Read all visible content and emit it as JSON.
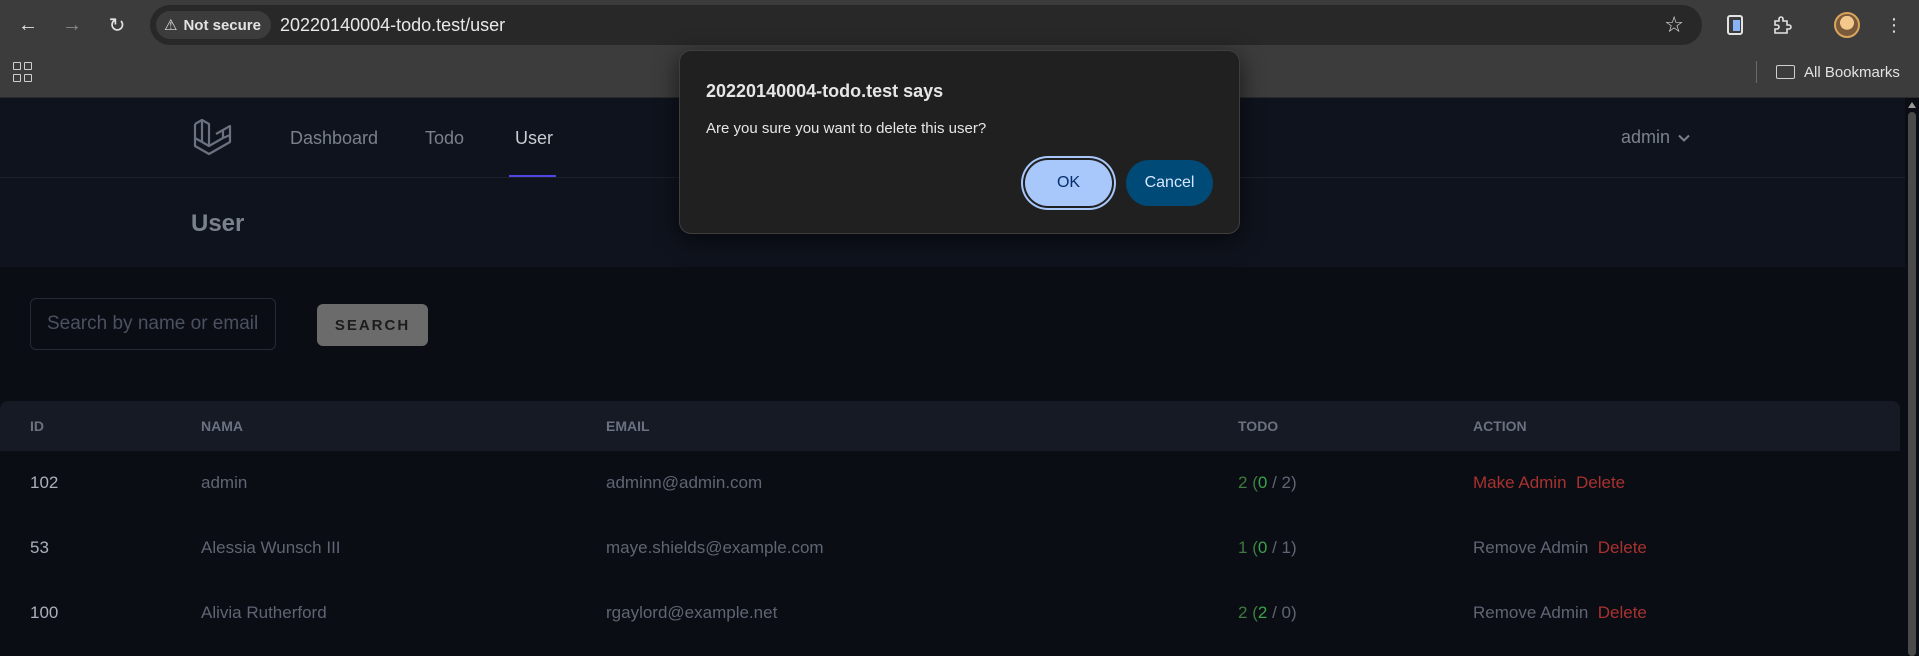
{
  "browser": {
    "security_label": "Not secure",
    "url": "20220140004-todo.test/user",
    "bookmarks_label": "All Bookmarks",
    "icons": [
      "back-arrow-icon",
      "forward-arrow-icon",
      "reload-icon",
      "warning-icon",
      "star-icon",
      "side-panel-icon",
      "extensions-icon",
      "profile-avatar",
      "kebab-menu-icon",
      "apps-grid-icon",
      "folder-icon"
    ]
  },
  "nav": {
    "links": [
      "Dashboard",
      "Todo",
      "User"
    ],
    "active": "User",
    "user_menu": "admin"
  },
  "header": {
    "title": "User"
  },
  "search": {
    "placeholder": "Search by name or email",
    "button_label": "SEARCH"
  },
  "table": {
    "headers": [
      "ID",
      "NAMA",
      "EMAIL",
      "TODO",
      "ACTION"
    ],
    "rows": [
      {
        "id": "102",
        "name": "admin",
        "email": "adminn@admin.com",
        "todo_total": "2",
        "todo_done": "0",
        "todo_rest": "2",
        "action_primary": "Make Admin",
        "action_delete": "Delete"
      },
      {
        "id": "53",
        "name": "Alessia Wunsch III",
        "email": "maye.shields@example.com",
        "todo_total": "1",
        "todo_done": "0",
        "todo_rest": "1",
        "action_primary": "Remove Admin",
        "action_delete": "Delete"
      },
      {
        "id": "100",
        "name": "Alivia Rutherford",
        "email": "rgaylord@example.net",
        "todo_total": "2",
        "todo_done": "2",
        "todo_rest": "0",
        "action_primary": "Remove Admin",
        "action_delete": "Delete"
      }
    ]
  },
  "dialog": {
    "title": "20220140004-todo.test says",
    "message": "Are you sure you want to delete this user?",
    "ok_label": "OK",
    "cancel_label": "Cancel"
  },
  "colors": {
    "page_bg": "#0a0d14",
    "accent_underline": "#4f46e5",
    "danger": "#a8322f",
    "todo_green": "#3aa34a",
    "dialog_ok": "#a8c7fa",
    "dialog_cancel": "#004a77"
  }
}
